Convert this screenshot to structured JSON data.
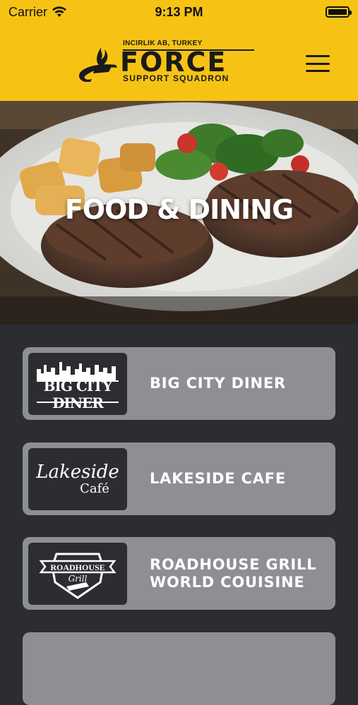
{
  "status_bar": {
    "carrier": "Carrier",
    "time": "9:13 PM",
    "battery_level": 1.0
  },
  "header": {
    "logo": {
      "top_text": "INCIRLIK AB, TURKEY",
      "main_text": "FORCE",
      "bottom_text": "SUPPORT SQUADRON"
    },
    "menu_icon": "hamburger-menu-icon"
  },
  "hero": {
    "title": "FOOD & DINING"
  },
  "restaurants": [
    {
      "name_lines": [
        "BIG CITY DINER"
      ],
      "logo_text": "BIG CITY DINER"
    },
    {
      "name_lines": [
        "LAKESIDE CAFE"
      ],
      "logo_text": [
        "Lakeside",
        "Café"
      ]
    },
    {
      "name_lines": [
        "ROADHOUSE GRILL",
        "WORLD COUISINE"
      ],
      "logo_text": [
        "ROADHOUSE",
        "Grill"
      ]
    }
  ],
  "colors": {
    "brand_yellow": "#f6c315",
    "card_gray": "#8e8f93",
    "background_dark": "#2b2d31"
  }
}
